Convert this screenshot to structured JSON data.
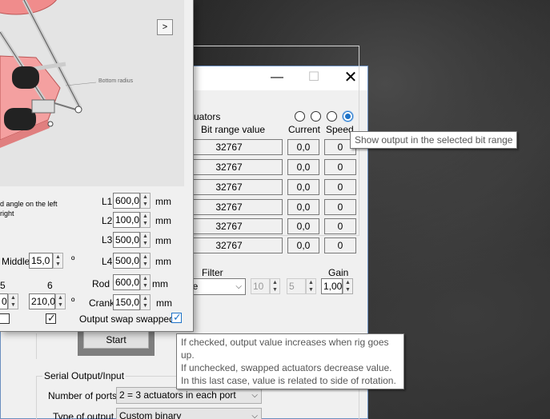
{
  "main_window": {
    "controls": {
      "minimize": "—",
      "maximize": "☐",
      "close": "✕"
    },
    "actuators": {
      "title": "uators",
      "headers": {
        "bit_range": "Bit range value",
        "current": "Current",
        "speed": "Speed"
      },
      "rows": [
        {
          "bit": "32767",
          "current": "0,0",
          "speed": "0"
        },
        {
          "bit": "32767",
          "current": "0,0",
          "speed": "0"
        },
        {
          "bit": "32767",
          "current": "0,0",
          "speed": "0"
        },
        {
          "bit": "32767",
          "current": "0,0",
          "speed": "0"
        },
        {
          "bit": "32767",
          "current": "0,0",
          "speed": "0"
        },
        {
          "bit": "32767",
          "current": "0,0",
          "speed": "0"
        }
      ],
      "filter_label": "Filter",
      "filter_value": "ne",
      "filter_a": "10",
      "filter_b": "5",
      "gain_label": "Gain",
      "gain_value": "1,00"
    },
    "start_button": "Start",
    "serial": {
      "title": "Serial Output/Input",
      "ports_label": "Number of ports",
      "ports_value": "2 = 3 actuators in each port",
      "type_label": "Type of output",
      "type_value": "Custom binary"
    }
  },
  "tooltips": {
    "bit_range": "Show output in the selected bit range",
    "swap": [
      "If checked, output value increases when rig goes up.",
      "If unchecked, swapped actuators decrease value.",
      "In this last case, value is related to side of rotation."
    ]
  },
  "left_window": {
    "diagram": {
      "next": ">",
      "bottom_radius": "Bottom radius"
    },
    "note_line1": "d angle on the left",
    "note_line2": "right",
    "middle_label": "Middle",
    "middle_value": "15,0",
    "middle_unit": "º",
    "col5": "5",
    "col6": "6",
    "val5": "0",
    "val6": "210,0",
    "val6_unit": "º",
    "params": [
      {
        "label": "L1",
        "value": "600,0",
        "unit": "mm"
      },
      {
        "label": "L2",
        "value": "100,0",
        "unit": "mm"
      },
      {
        "label": "L3",
        "value": "500,0",
        "unit": "mm"
      },
      {
        "label": "L4",
        "value": "500,0",
        "unit": "mm"
      },
      {
        "label": "Rod",
        "value": "600,0",
        "unit": "mm"
      },
      {
        "label": "Crank",
        "value": "150,0",
        "unit": "mm"
      }
    ],
    "swap_label": "Output swap swapped"
  }
}
